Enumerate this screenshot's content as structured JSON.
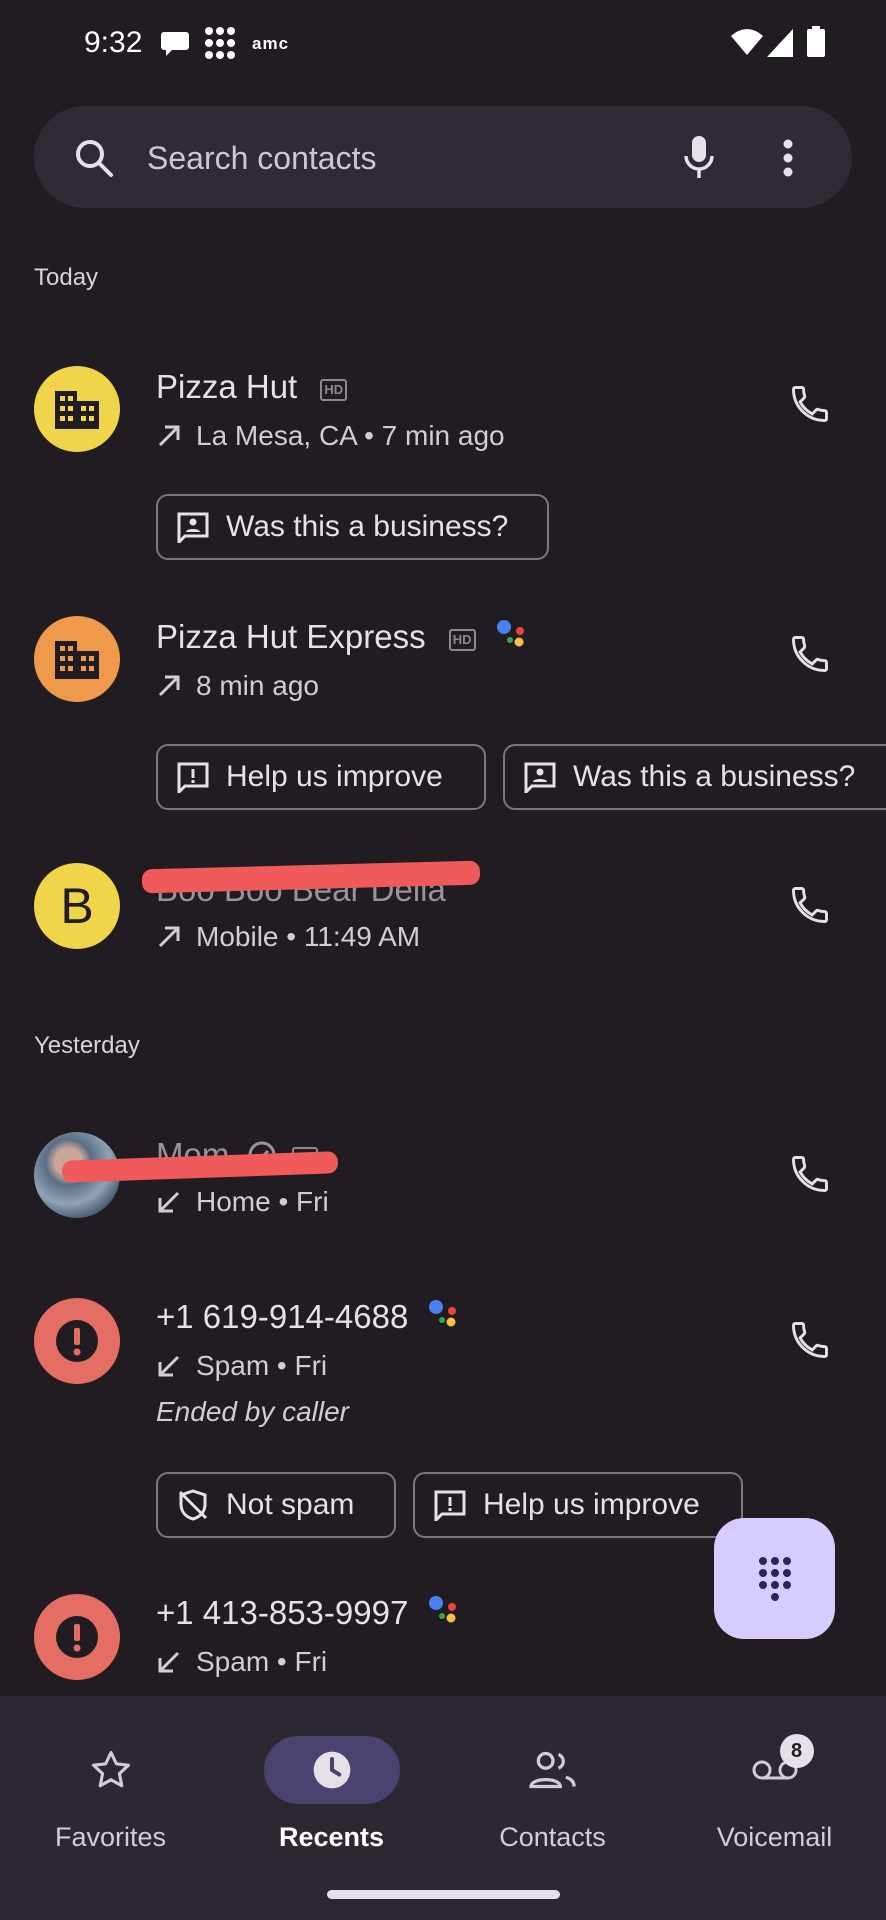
{
  "status_bar": {
    "time": "9:32",
    "amc_text": "amc"
  },
  "search": {
    "placeholder": "Search contacts"
  },
  "sections": {
    "today": "Today",
    "yesterday": "Yesterday"
  },
  "calls": [
    {
      "name": "Pizza Hut",
      "detail": "La Mesa, CA • 7 min ago",
      "avatar_color": "#f0d44a"
    },
    {
      "name": "Pizza Hut Express",
      "detail": "8 min ago",
      "avatar_color": "#ef9a4b"
    },
    {
      "name": "Boo Boo Bear Della",
      "detail": "Mobile • 11:49 AM",
      "avatar_letter": "B",
      "avatar_color": "#f0d44a"
    },
    {
      "name": "Mom",
      "detail": "Home • Fri"
    },
    {
      "name": "+1 619-914-4688",
      "detail": "Spam • Fri",
      "note": "Ended by caller",
      "avatar_color": "#e46e64"
    },
    {
      "name": "+1 413-853-9997",
      "detail": "Spam • Fri",
      "avatar_color": "#e46e64"
    }
  ],
  "chips": {
    "was_business": "Was this a business?",
    "help_improve": "Help us improve",
    "not_spam": "Not spam"
  },
  "nav": {
    "favorites": "Favorites",
    "recents": "Recents",
    "contacts": "Contacts",
    "voicemail": "Voicemail",
    "voicemail_badge": "8"
  }
}
